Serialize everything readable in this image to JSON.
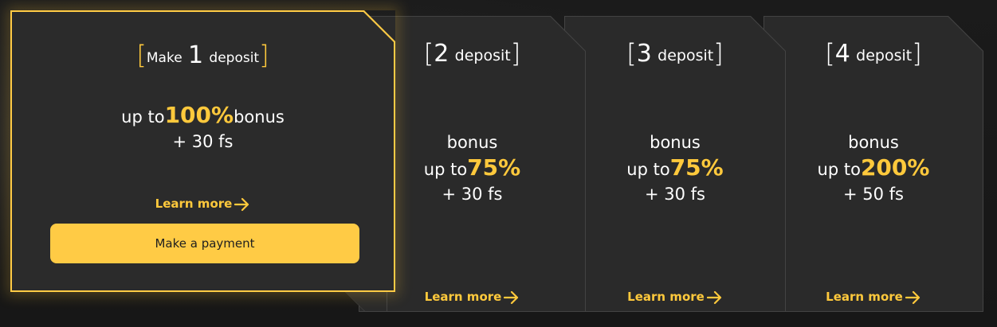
{
  "accent_color": "#ffc93c",
  "cards": [
    {
      "bracket_open": "[",
      "prefix": "Make",
      "number": "1",
      "word": "deposit",
      "bracket_close": "]",
      "line1_pre": "up to",
      "percent": "100%",
      "line1_post": "bonus",
      "line2": "+ 30 fs",
      "learn_more": "Learn more",
      "button": "Make a payment"
    },
    {
      "bracket_open": "[",
      "number": "2",
      "word": "deposit",
      "bracket_close": "]",
      "line0": "bonus",
      "line1_pre": "up to",
      "percent": "75%",
      "line2": "+ 30 fs",
      "learn_more": "Learn more"
    },
    {
      "bracket_open": "[",
      "number": "3",
      "word": "deposit",
      "bracket_close": "]",
      "line0": "bonus",
      "line1_pre": "up to",
      "percent": "75%",
      "line2": "+ 30 fs",
      "learn_more": "Learn more"
    },
    {
      "bracket_open": "[",
      "number": "4",
      "word": "deposit",
      "bracket_close": "]",
      "line0": "bonus",
      "line1_pre": "up to",
      "percent": "200%",
      "line2": "+ 50 fs",
      "learn_more": "Learn more"
    }
  ]
}
